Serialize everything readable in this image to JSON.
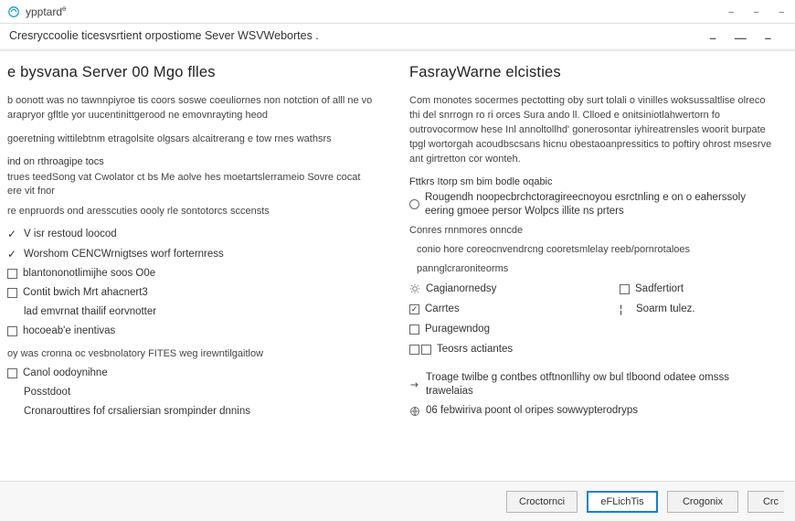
{
  "titlebar": {
    "app_name": "ypptard",
    "sup": "e"
  },
  "window_controls": {
    "minimize": "–",
    "maximize": "–",
    "close": "–"
  },
  "subheader": {
    "breadcrumb": "Cresryccoolie ticesvsrtient orpostiome Sever WSVWebortes ."
  },
  "sub_controls": {
    "a": "–",
    "b": "—",
    "c": "–"
  },
  "left": {
    "heading": "e bysvana Server 00 Mgo flles",
    "para1": "b oonott was no tawnnpiyroe tis coors soswe coeuliornes non notction of alll ne vo arapryor gfltle yor uucentinittgerood ne emovnrayting heod",
    "para2": "goeretning wittilebtnm etragolsite olgsars alcaitrerang e tow rnes wathsrs",
    "label1": "ind on rthroagipe tocs",
    "line1": "trues teedSong vat Cwolator ct bs Me aolve hes moetartslerrameio Sovre cocat ere vit fnor",
    "line2": "re enpruords ond aresscuties oooly rle sontotorcs sccensts",
    "checklist": [
      {
        "label": "V isr restoud loocod",
        "type": "tick"
      },
      {
        "label": "Worshom CENCWrnigtses worf forternress",
        "type": "tick"
      },
      {
        "label": "blantononotlimijhe soos O0e",
        "type": "check"
      },
      {
        "label": "Contit bwich Mrt ahacnert3",
        "type": "check"
      },
      {
        "label": "lad emvrnat thailif eorvnotter",
        "type": "none"
      },
      {
        "label": "hocoeab'e inentivas",
        "type": "check"
      }
    ],
    "line3": "oy was cronna oc vesbnolatory FITES weg irewntilgaitlow",
    "bottomlist": [
      {
        "label": "Canol oodoynihne",
        "type": "check"
      },
      {
        "label": "Posstdoot",
        "type": "none"
      },
      {
        "label": "Cronarouttires fof crsaliersian srompinder dnnins",
        "type": "none"
      }
    ]
  },
  "right": {
    "heading": "FasrayWarne elcisties",
    "para1": "Com monotes socermes pectotting oby surt tolali o vinilles woksussaltlise olreco thi del snrrogn ro ri orces Sura ando ll. Clloed e onitsiniotlahwertorn fo outrovocormow hese Inl annoltollhd' gonerosontar iyhireatrensles woorit burpate tpgl wortorgah acoudbscsans hicnu obestaoanpressitics to poftiry ohrost msesrve ant girtretton cor wonteh.",
    "label1": "Fttkrs Itorp sm bim bodle oqabic",
    "line1": "Rougendh noopecbrchctoragireecnoyou esrctnling e on o eaherssoly eering gmoee persor Wolpcs illite ns prters",
    "line2": "Conres rnnmores onncde",
    "indentlines": [
      "conio hore coreocnvendrcng cooretsmlelay reeb/pornrotaloes",
      "pannglcraroniteorms"
    ],
    "checkcols": {
      "left": [
        {
          "label": "Cagianornedsy",
          "icon": "gear"
        },
        {
          "label": "Carrtes",
          "type": "check-checked"
        },
        {
          "label": "Puragewndog",
          "type": "check"
        },
        {
          "label": "Teosrs actiantes",
          "type": "check-double"
        }
      ],
      "right": [
        {
          "label": "Sadfertiort",
          "type": "check"
        },
        {
          "label": "Soarm tulez.",
          "type": "none"
        }
      ]
    },
    "bottom": [
      {
        "label": "Troage twilbe g contbes otftnonllihy ow bul tlboond odatee omsss trawelaias",
        "icon": "arrow"
      },
      {
        "label": "06 febwiriva poont ol oripes sowwypterodryps",
        "icon": "globe"
      }
    ]
  },
  "footer": {
    "btn1": "Croctornci",
    "btn2": "eFLichTis",
    "btn3": "Crogonix",
    "btn4": "Crc"
  }
}
